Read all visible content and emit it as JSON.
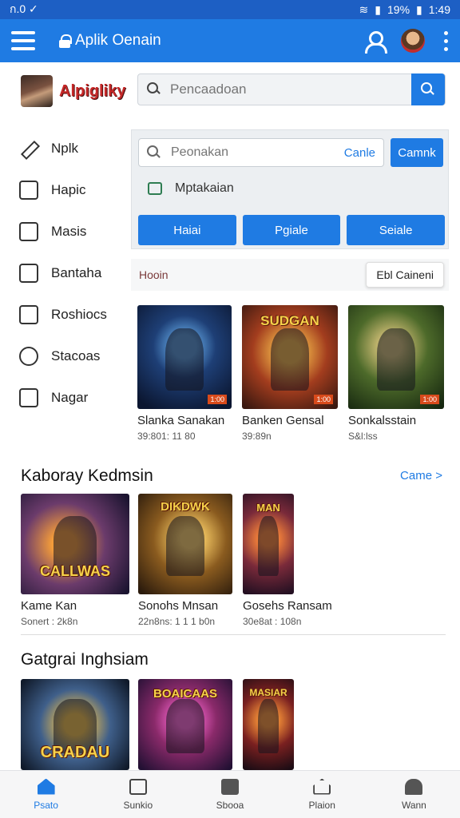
{
  "status": {
    "time_left": "ก.0 ✓",
    "battery": "19%",
    "time": "1:49"
  },
  "appbar": {
    "title": "Aplik Oenain"
  },
  "profile": {
    "name": "Alpigliky"
  },
  "search": {
    "placeholder": "Pencaadoan"
  },
  "sidebar": {
    "items": [
      {
        "label": "Nplk",
        "icon": "pencil-icon"
      },
      {
        "label": "Hapic",
        "icon": "bookmark-icon"
      },
      {
        "label": "Masis",
        "icon": "square-icon"
      },
      {
        "label": "Bantaha",
        "icon": "grid-icon"
      },
      {
        "label": "Roshiocs",
        "icon": "tag-icon"
      },
      {
        "label": "Stacoas",
        "icon": "circle-icon"
      },
      {
        "label": "Nagar",
        "icon": "folder-icon"
      }
    ]
  },
  "panel": {
    "input_placeholder": "Peonakan",
    "cancel": "Canle",
    "button": "Camnk",
    "hint": "Mptakaian",
    "tabs": [
      "Haiai",
      "Pgiale",
      "Seiale"
    ]
  },
  "section_bar": {
    "label": "Hooin",
    "button": "Ebl Caineni"
  },
  "row1": [
    {
      "title": "Slanka Sanakan",
      "sub": "39:801: 11 80"
    },
    {
      "title": "Banken Gensal",
      "sub": "39:89n"
    },
    {
      "title": "Sonkalsstain",
      "sub": "S&l:lss"
    }
  ],
  "section2": {
    "title": "Kaboray Kedmsin",
    "more": "Came >"
  },
  "row2": [
    {
      "title": "Kame Kan",
      "sub": "Sonert : 2k8n",
      "art_text": "CALLWAS"
    },
    {
      "title": "Sonohs Mnsan",
      "sub": "22n8ns: 1 1 1 b0n",
      "art_text": "DIKDWK"
    },
    {
      "title": "Gosehs Ransam",
      "sub": "30e8at : 108n",
      "art_text": "MAN"
    }
  ],
  "section3": {
    "title": "Gatgrai Inghsiam"
  },
  "row3": [
    {
      "art_text": "CRADAU"
    },
    {
      "art_text": "BOAICAAS"
    },
    {
      "art_text": "MASIAR"
    }
  ],
  "row1_art_text": [
    "",
    "SUDGAN",
    ""
  ],
  "bottomnav": [
    {
      "label": "Psato",
      "icon": "home-icon"
    },
    {
      "label": "Sunkio",
      "icon": "document-icon"
    },
    {
      "label": "Sbooa",
      "icon": "box-icon"
    },
    {
      "label": "Plaion",
      "icon": "house-icon"
    },
    {
      "label": "Wann",
      "icon": "person-icon"
    }
  ]
}
